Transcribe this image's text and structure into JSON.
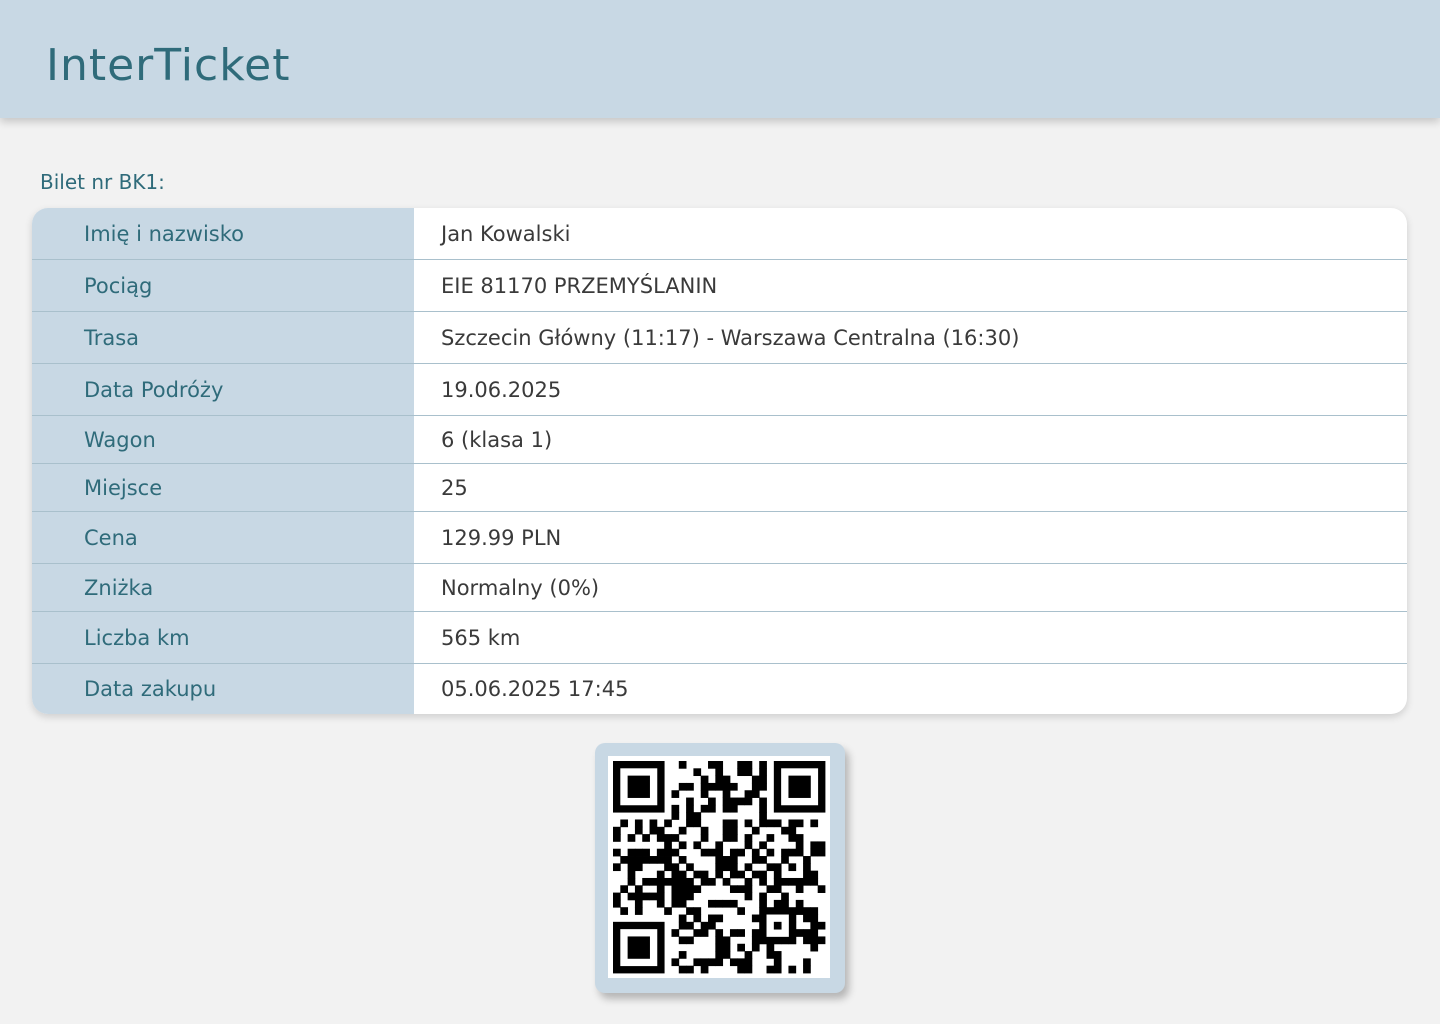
{
  "header": {
    "brand": "InterTicket"
  },
  "ticket": {
    "label": "Bilet nr BK1:",
    "rows": [
      {
        "label": "Imię i nazwisko",
        "value": "Jan Kowalski"
      },
      {
        "label": "Pociąg",
        "value": "EIE 81170 PRZEMYŚLANIN"
      },
      {
        "label": "Trasa",
        "value": "Szczecin Główny (11:17) - Warszawa Centralna (16:30)"
      },
      {
        "label": "Data Podróży",
        "value": "19.06.2025"
      },
      {
        "label": "Wagon",
        "value": "6 (klasa 1)"
      },
      {
        "label": "Miejsce",
        "value": "25"
      },
      {
        "label": "Cena",
        "value": "129.99 PLN"
      },
      {
        "label": "Zniżka",
        "value": "Normalny (0%)"
      },
      {
        "label": "Liczba km",
        "value": "565 km"
      },
      {
        "label": "Data zakupu",
        "value": "05.06.2025 17:45"
      }
    ]
  },
  "qr": {
    "icon": "qr-code-icon",
    "frame_color": "#c8d8e4"
  },
  "colors": {
    "accent": "#2f6b7a",
    "header_bg": "#c8d8e4",
    "page_bg": "#f2f2f2"
  }
}
